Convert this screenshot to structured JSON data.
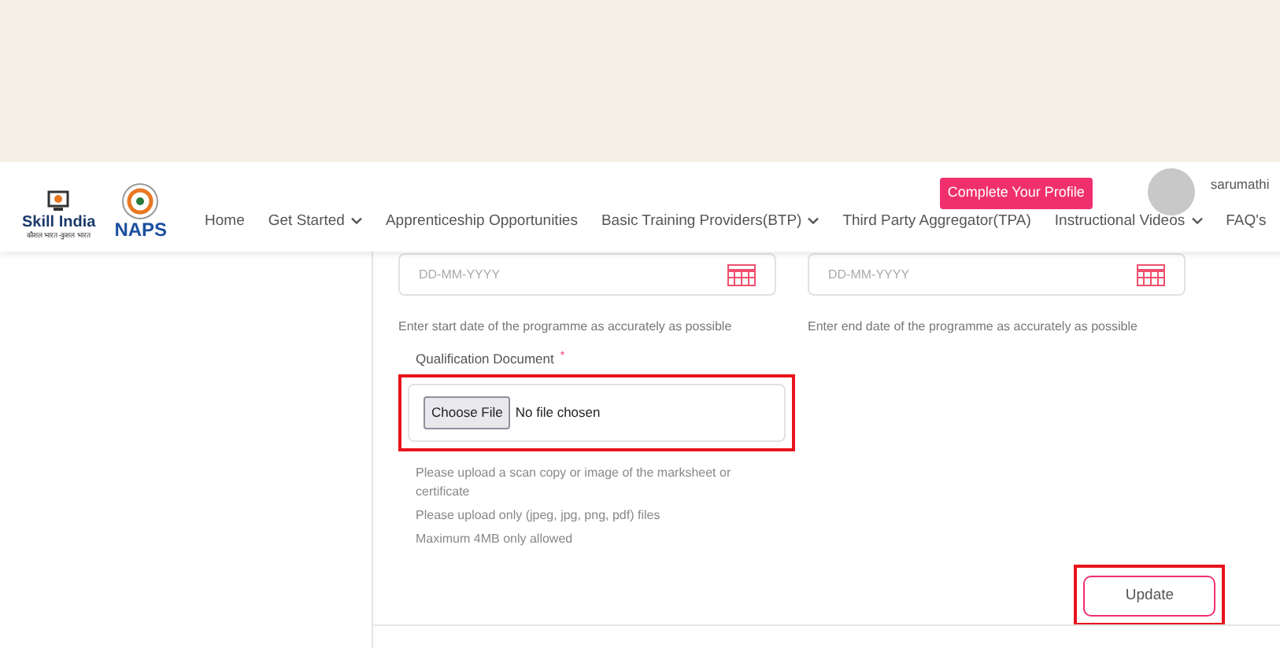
{
  "header": {
    "skill_logo": {
      "title": "Skill India",
      "subtitle": "कौशल भारत-कुशल भारत"
    },
    "naps_logo": {
      "title": "NAPS"
    },
    "profile_button": "Complete Your Profile",
    "username": "sarumathi",
    "nav": [
      {
        "label": "Home",
        "dropdown": false
      },
      {
        "label": "Get Started",
        "dropdown": true
      },
      {
        "label": "Apprenticeship Opportunities",
        "dropdown": false
      },
      {
        "label": "Basic Training Providers(BTP)",
        "dropdown": true
      },
      {
        "label": "Third Party Aggregator(TPA)",
        "dropdown": false
      },
      {
        "label": "Instructional Videos",
        "dropdown": true
      },
      {
        "label": "FAQ's",
        "dropdown": false
      }
    ]
  },
  "date_fields": [
    {
      "placeholder": "DD-MM-YYYY",
      "hint": "Enter start date of the programme as accurately as possible"
    },
    {
      "placeholder": "DD-MM-YYYY",
      "hint": "Enter end date of the programme as accurately as possible"
    }
  ],
  "qualification": {
    "label": "Qualification Document",
    "required_mark": "*",
    "button": "Choose File",
    "status": "No file chosen",
    "highlighted": true,
    "hints": [
      "Please upload a scan copy or image of the marksheet or certificate",
      "Please upload only (jpeg, jpg, png, pdf) files",
      "Maximum 4MB only allowed"
    ]
  },
  "update_button": {
    "label": "Update",
    "highlighted": true
  }
}
